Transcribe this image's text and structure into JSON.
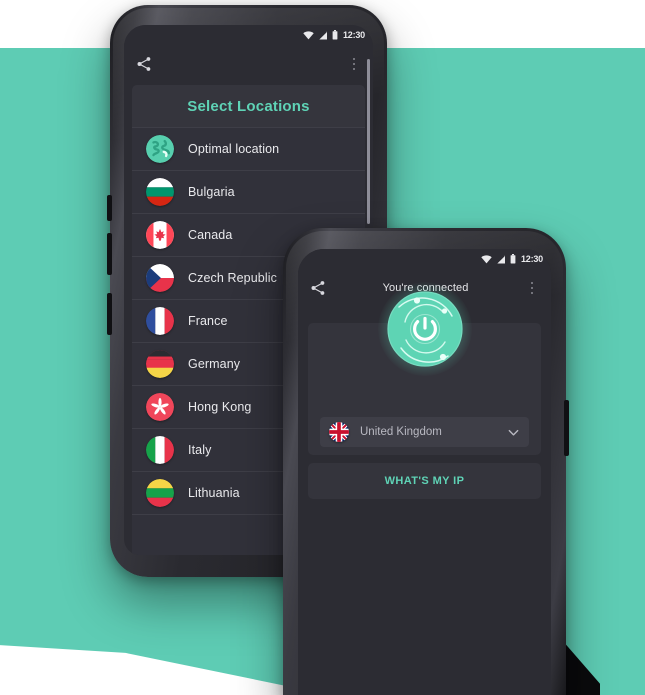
{
  "theme": {
    "background_teal": "#5ECCB4",
    "accent_mint": "#5FD3B6",
    "screen_bg": "#2C2C33",
    "card_bg": "#34343C",
    "row_bg": "#31313A",
    "text_primary": "#E9E9EC",
    "text_muted": "#B9B9C2"
  },
  "phone_locations": {
    "statusbar": {
      "clock": "12:30",
      "icons": [
        "wifi-icon",
        "signal-icon",
        "battery-icon"
      ]
    },
    "appbar": {
      "share_label": "share-icon",
      "title": "",
      "menu_label": "more-options-icon"
    },
    "list": {
      "header": "Select Locations",
      "items": [
        {
          "label": "Optimal location",
          "flag": "globe"
        },
        {
          "label": "Bulgaria",
          "flag": "bg"
        },
        {
          "label": "Canada",
          "flag": "ca"
        },
        {
          "label": "Czech Republic",
          "flag": "cz"
        },
        {
          "label": "France",
          "flag": "fr"
        },
        {
          "label": "Germany",
          "flag": "de"
        },
        {
          "label": "Hong Kong",
          "flag": "hk"
        },
        {
          "label": "Italy",
          "flag": "it"
        },
        {
          "label": "Lithuania",
          "flag": "lt"
        }
      ]
    }
  },
  "phone_connected": {
    "statusbar": {
      "clock": "12:30",
      "icons": [
        "wifi-icon",
        "signal-icon",
        "battery-icon"
      ]
    },
    "appbar": {
      "share_label": "share-icon",
      "title": "You're connected",
      "menu_label": "more-options-icon"
    },
    "power": {
      "state": "on",
      "icon": "power-icon"
    },
    "country": {
      "name": "United Kingdom",
      "flag": "gb",
      "chevron": "chevron-down-icon"
    },
    "ip_button": {
      "label": "WHAT'S MY IP"
    }
  }
}
